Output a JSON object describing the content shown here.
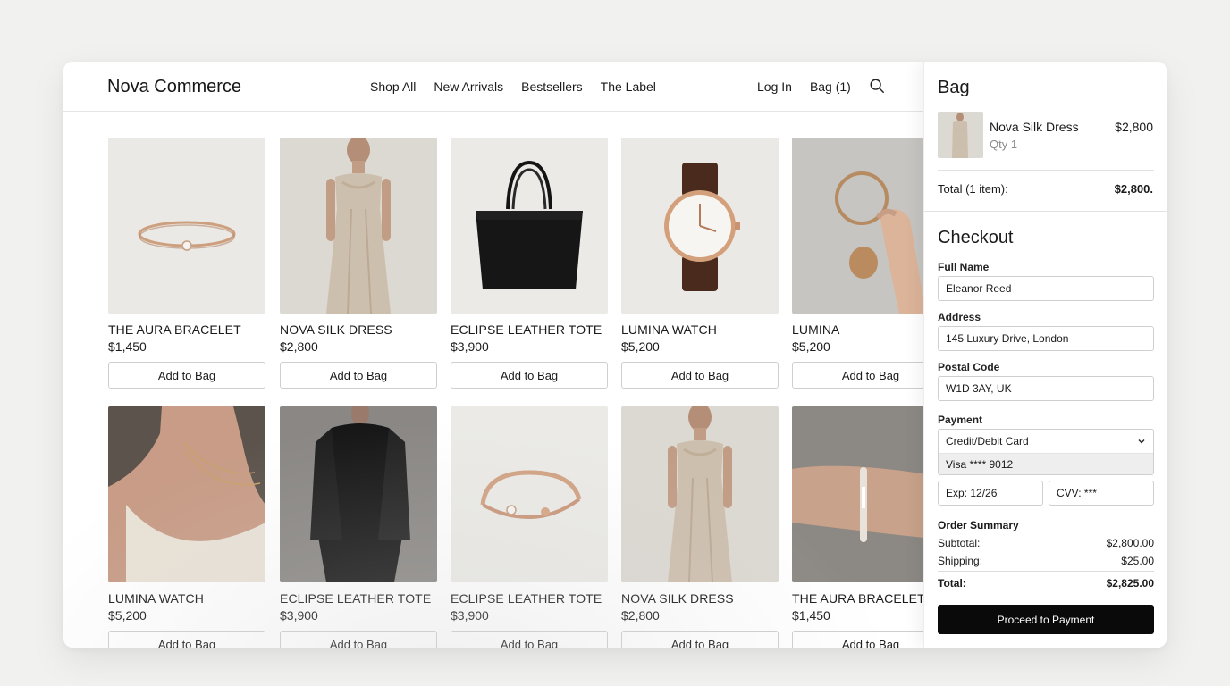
{
  "header": {
    "brand": "Nova Commerce",
    "nav": [
      "Shop All",
      "New Arrivals",
      "Bestsellers",
      "The Label"
    ],
    "login": "Log In",
    "bag": "Bag (1)"
  },
  "products": [
    {
      "name": "THE AURA BRACELET",
      "price": "$1,450",
      "button": "Add to Bag",
      "image": "ring"
    },
    {
      "name": "NOVA SILK DRESS",
      "price": "$2,800",
      "button": "Add to Bag",
      "image": "dress"
    },
    {
      "name": "ECLIPSE LEATHER TOTE",
      "price": "$3,900",
      "button": "Add to Bag",
      "image": "tote"
    },
    {
      "name": "LUMINA WATCH",
      "price": "$5,200",
      "button": "Add to Bag",
      "image": "watch"
    },
    {
      "name": "LUMINA",
      "price": "$5,200",
      "button": "Add to Bag",
      "image": "bangle-hand"
    },
    {
      "name": "LUMINA WATCH",
      "price": "$5,200",
      "button": "Add to Bag",
      "image": "necklace-model"
    },
    {
      "name": "ECLIPSE LEATHER TOTE",
      "price": "$3,900",
      "button": "Add to Bag",
      "image": "black-jacket"
    },
    {
      "name": "ECLIPSE LEATHER TOTE",
      "price": "$3,900",
      "button": "Add to Bag",
      "image": "cuff"
    },
    {
      "name": "NOVA SILK DRESS",
      "price": "$2,800",
      "button": "Add to Bag",
      "image": "dress"
    },
    {
      "name": "THE AURA BRACELET",
      "price": "$1,450",
      "button": "Add to Bag",
      "image": "bracelet-wrist"
    }
  ],
  "bag_panel": {
    "title": "Bag",
    "item": {
      "name": "Nova Silk Dress",
      "qty": "Qty 1",
      "price": "$2,800"
    },
    "total_label": "Total (1 item):",
    "total_value": "$2,800."
  },
  "checkout": {
    "title": "Checkout",
    "full_name_label": "Full Name",
    "full_name_value": "Eleanor Reed",
    "address_label": "Address",
    "address_value": "145 Luxury Drive, London",
    "postal_label": "Postal Code",
    "postal_value": "W1D 3AY, UK",
    "payment_label": "Payment",
    "payment_selected": "Credit/Debit Card",
    "payment_option": "Visa **** 9012",
    "exp_value": "Exp: 12/26",
    "cvv_value": "CVV: ***",
    "summary_title": "Order Summary",
    "subtotal_label": "Subtotal:",
    "subtotal_value": "$2,800.00",
    "shipping_label": "Shipping:",
    "shipping_value": "$25.00",
    "total_label": "Total:",
    "total_value": "$2,825.00",
    "pay_button": "Proceed to Payment"
  },
  "colors": {
    "accent": "#0a0a0a",
    "background": "#f1f1f0",
    "gold": "#c9a07e"
  }
}
